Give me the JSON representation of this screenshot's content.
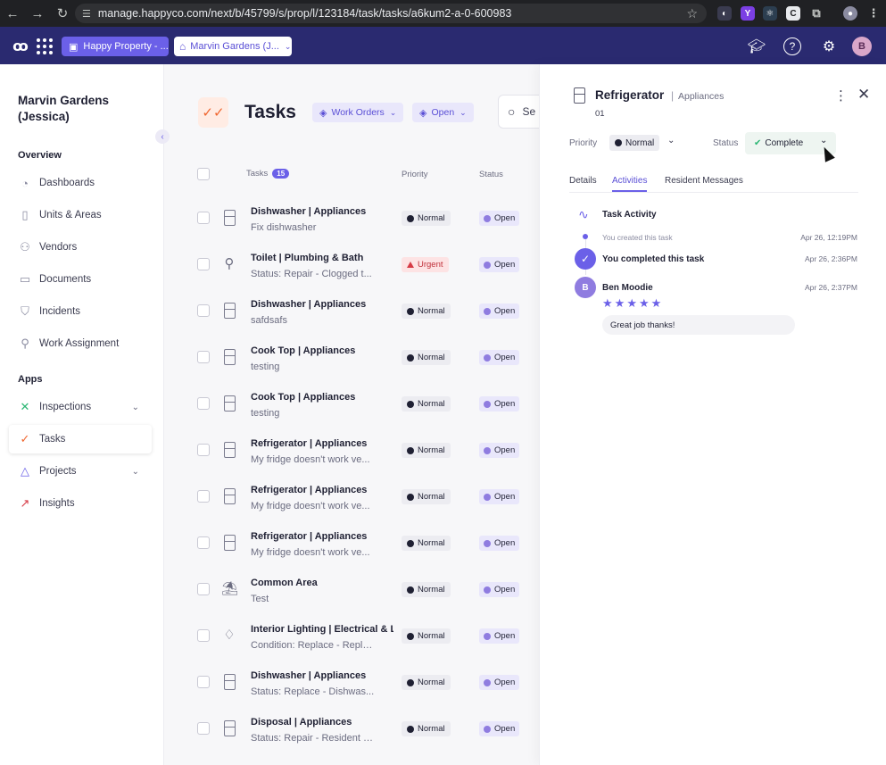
{
  "browser": {
    "url": "manage.happyco.com/next/b/45799/s/prop/l/123184/task/tasks/a6kum2-a-0-600983"
  },
  "appbar": {
    "property_switcher": "Happy Property - ...",
    "site_switcher": "Marvin Gardens (J...",
    "avatar_initial": "B"
  },
  "sidebar": {
    "site_name": "Marvin Gardens (Jessica)",
    "overview_label": "Overview",
    "apps_label": "Apps",
    "overview_items": [
      {
        "label": "Dashboards",
        "icon": "dashboard-icon"
      },
      {
        "label": "Units & Areas",
        "icon": "door-icon"
      },
      {
        "label": "Vendors",
        "icon": "people-icon"
      },
      {
        "label": "Documents",
        "icon": "folder-icon"
      },
      {
        "label": "Incidents",
        "icon": "shield-icon"
      },
      {
        "label": "Work Assignment",
        "icon": "assign-icon"
      }
    ],
    "app_items": [
      {
        "label": "Inspections",
        "icon": "inspections-icon"
      },
      {
        "label": "Tasks",
        "icon": "tasks-icon"
      },
      {
        "label": "Projects",
        "icon": "projects-icon"
      },
      {
        "label": "Insights",
        "icon": "insights-icon"
      }
    ]
  },
  "main": {
    "title": "Tasks",
    "filter_work_orders": "Work Orders",
    "filter_open": "Open",
    "search_placeholder": "Se",
    "columns": {
      "tasks": "Tasks",
      "count": "15",
      "priority": "Priority",
      "status": "Status"
    },
    "rows": [
      {
        "title": "Dishwasher | Appliances",
        "sub": "Fix dishwasher",
        "priority": "Normal",
        "status": "Open",
        "icon": "fridge-icon"
      },
      {
        "title": "Toilet | Plumbing & Bath",
        "sub": "Status: Repair - Clogged t...",
        "priority": "Urgent",
        "status": "Open",
        "icon": "shower-icon"
      },
      {
        "title": "Dishwasher | Appliances",
        "sub": "safdsafs",
        "priority": "Normal",
        "status": "Open",
        "icon": "fridge-icon"
      },
      {
        "title": "Cook Top | Appliances",
        "sub": "testing",
        "priority": "Normal",
        "status": "Open",
        "icon": "fridge-icon"
      },
      {
        "title": "Cook Top | Appliances",
        "sub": "testing",
        "priority": "Normal",
        "status": "Open",
        "icon": "fridge-icon"
      },
      {
        "title": "Refrigerator | Appliances",
        "sub": "My fridge doesn't work ve...",
        "priority": "Normal",
        "status": "Open",
        "icon": "fridge-icon"
      },
      {
        "title": "Refrigerator | Appliances",
        "sub": "My fridge doesn't work ve...",
        "priority": "Normal",
        "status": "Open",
        "icon": "fridge-icon"
      },
      {
        "title": "Refrigerator | Appliances",
        "sub": "My fridge doesn't work ve...",
        "priority": "Normal",
        "status": "Open",
        "icon": "fridge-icon"
      },
      {
        "title": "Common Area",
        "sub": "Test",
        "priority": "Normal",
        "status": "Open",
        "icon": "lounge-icon"
      },
      {
        "title": "Interior Lighting | Electrical & L",
        "sub": "Condition: Replace - Replacem",
        "priority": "Normal",
        "status": "Open",
        "icon": "lamp-icon"
      },
      {
        "title": "Dishwasher | Appliances",
        "sub": "Status: Replace - Dishwas...",
        "priority": "Normal",
        "status": "Open",
        "icon": "fridge-icon"
      },
      {
        "title": "Disposal | Appliances",
        "sub": "Status: Repair - Resident c...",
        "priority": "Normal",
        "status": "Open",
        "icon": "fridge-icon"
      }
    ]
  },
  "panel": {
    "title": "Refrigerator",
    "separator": "|",
    "category": "Appliances",
    "number": "01",
    "priority_label": "Priority",
    "priority_value": "Normal",
    "status_label": "Status",
    "status_value": "Complete",
    "tabs": [
      "Details",
      "Activities",
      "Resident Messages"
    ],
    "activity_heading": "Task Activity",
    "events": {
      "created_text": "You created this task",
      "created_time": "Apr 26, 12:19PM",
      "completed_text": "You completed this task",
      "completed_time": "Apr 26, 2:36PM",
      "reviewer_initial": "B",
      "reviewer_name": "Ben Moodie",
      "reviewer_time": "Apr 26, 2:37PM",
      "rating": 5,
      "comment": "Great job thanks!"
    }
  },
  "colors": {
    "accent": "#6b60e8",
    "appbar": "#2a2a70",
    "urgent": "#d63a45",
    "complete": "#2bb673"
  }
}
